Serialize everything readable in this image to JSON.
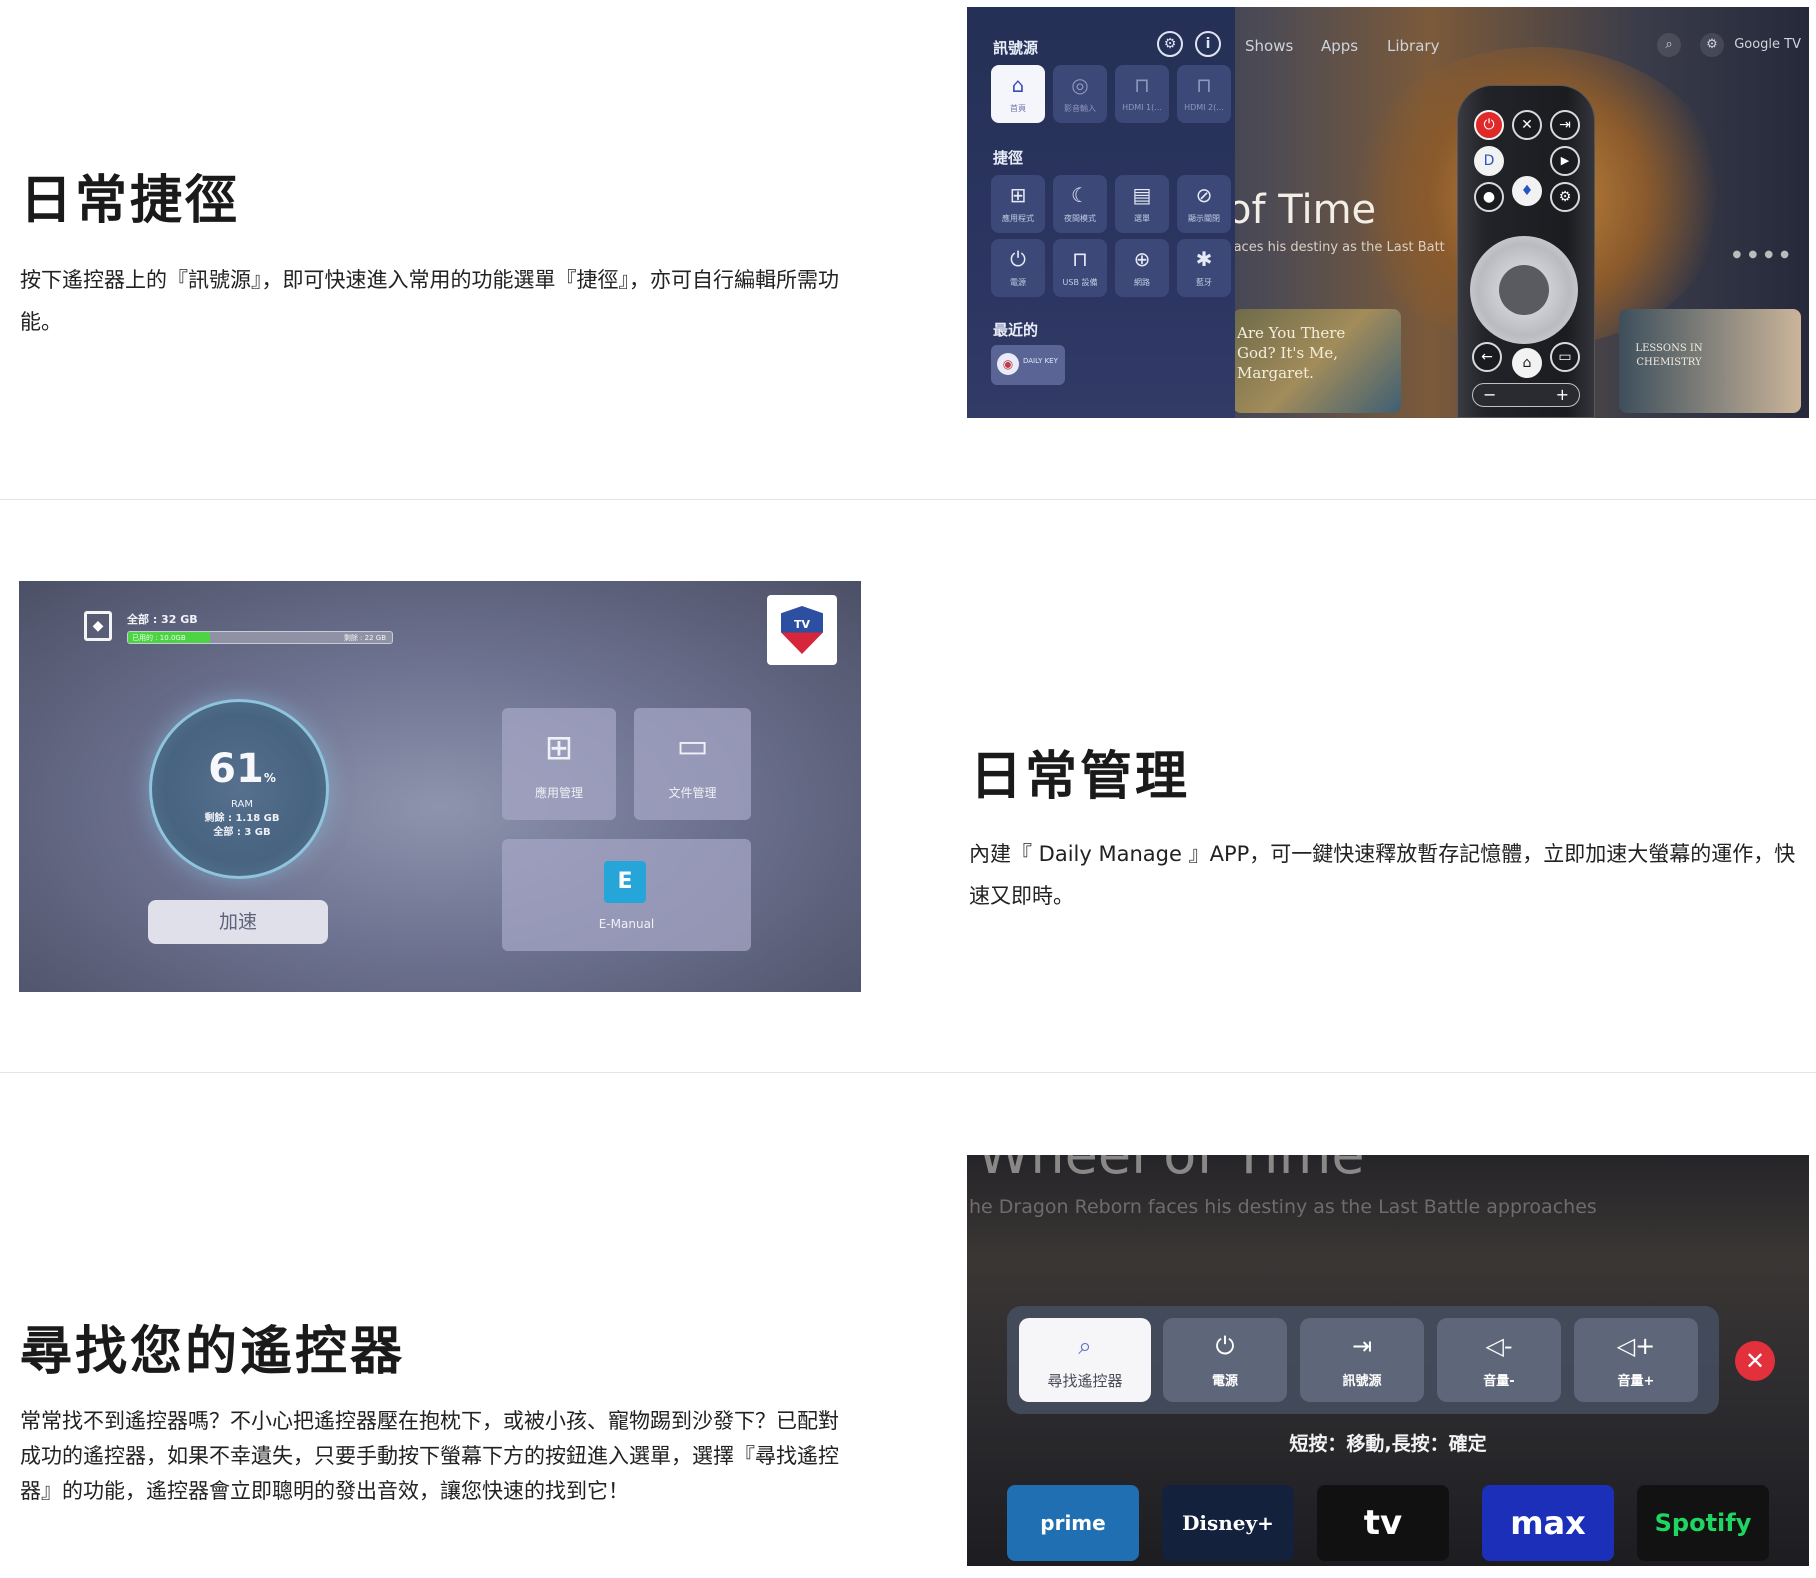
{
  "section_shortcuts": {
    "heading": "日常捷徑",
    "body": "按下遙控器上的『訊號源』，即可快速進入常用的功能選單『捷徑』，亦可自行編輯所需功能。",
    "screen": {
      "tv_nav": [
        "Shows",
        "Apps",
        "Library"
      ],
      "tv_brand": "Google TV",
      "hero_title": "of Time",
      "hero_subtitle": "faces his destiny as the Last Batt",
      "tile_a_text": "Are You There God? It's Me, Margaret.",
      "tile_b_text": "LESSONS IN CHEMISTRY",
      "panel": {
        "source_label": "訊號源",
        "shortcuts_label": "捷徑",
        "recent_label": "最近的",
        "sources": [
          {
            "icon": "home-icon",
            "glyph": "⌂",
            "label": "首頁"
          },
          {
            "icon": "video-input-icon",
            "glyph": "◎",
            "label": "影音輸入"
          },
          {
            "icon": "hdmi-icon",
            "glyph": "⊓",
            "label": "HDMI 1(..."
          },
          {
            "icon": "hdmi-icon",
            "glyph": "⊓",
            "label": "HDMI 2(..."
          }
        ],
        "shortcuts": [
          {
            "icon": "apps-icon",
            "glyph": "⊞",
            "label": "應用程式"
          },
          {
            "icon": "night-mode-icon",
            "glyph": "☾",
            "label": "夜間模式"
          },
          {
            "icon": "menu-icon",
            "glyph": "▤",
            "label": "選單"
          },
          {
            "icon": "display-off-icon",
            "glyph": "⊘",
            "label": "顯示關閉"
          },
          {
            "icon": "power-icon",
            "glyph": "⏻",
            "label": "電源"
          },
          {
            "icon": "usb-icon",
            "glyph": "⊓",
            "label": "USB 設備"
          },
          {
            "icon": "network-icon",
            "glyph": "⊕",
            "label": "網路"
          },
          {
            "icon": "bluetooth-icon",
            "glyph": "✱",
            "label": "藍牙"
          }
        ],
        "recent_app": "DAILY KEY"
      }
    }
  },
  "section_manage": {
    "heading": "日常管理",
    "body": "內建『 Daily Manage 』APP，可一鍵快速釋放暫存記憶體，立即加速大螢幕的運作，快速又即時。",
    "screen": {
      "storage_total": "全部 : 32 GB",
      "storage_used": "已用的 : 10.0GB",
      "storage_left": "剩餘 : 22 GB",
      "storage_used_fraction": 0.31,
      "tv_badge": "TV",
      "ram_percent": "61",
      "ram_percent_unit": "%",
      "ram_label": "RAM",
      "ram_left": "剩餘 : 1.18 GB",
      "ram_total": "全部 : 3 GB",
      "boost_button": "加速",
      "app_manage": "應用管理",
      "file_manage": "文件管理",
      "emanual": "E-Manual"
    }
  },
  "section_find": {
    "heading": "尋找您的遙控器",
    "body": "常常找不到遙控器嗎？不小心把遙控器壓在抱枕下，或被小孩、寵物踢到沙發下？已配對成功的遙控器，如果不幸遺失，只要手動按下螢幕下方的按鈕進入選單，選擇『尋找遙控器』的功能，遙控器會立即聰明的發出音效，讓您快速的找到它！",
    "screen": {
      "bg_title": "Wheel of Time",
      "bg_subtitle": "he Dragon Reborn faces his destiny as the Last Battle approaches",
      "actions": [
        {
          "icon": "find-remote-icon",
          "glyph": "⌕",
          "label": "尋找遙控器"
        },
        {
          "icon": "power-icon",
          "glyph": "⏻",
          "label": "電源"
        },
        {
          "icon": "input-source-icon",
          "glyph": "⇥",
          "label": "訊號源"
        },
        {
          "icon": "volume-down-icon",
          "glyph": "◁-",
          "label": "音量-"
        },
        {
          "icon": "volume-up-icon",
          "glyph": "◁+",
          "label": "音量+"
        }
      ],
      "hint": "短按：移動,長按：確定",
      "apps": [
        "prime video",
        "Disney+",
        "tv",
        "max",
        "Spotify"
      ]
    }
  },
  "colors": {
    "accent_red": "#e02a2a",
    "panel_blue": "#253056",
    "green_bar": "#4cd444"
  }
}
